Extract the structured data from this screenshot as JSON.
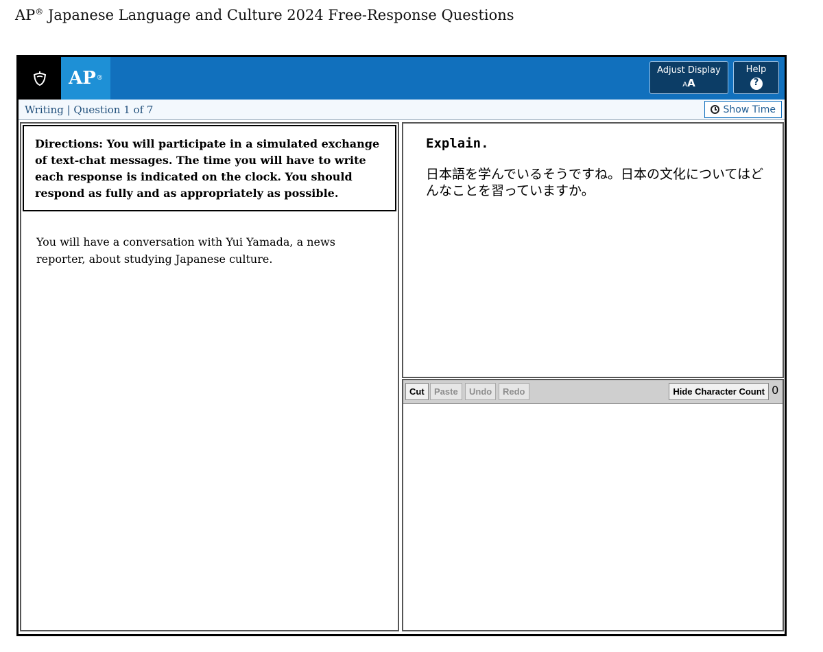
{
  "document": {
    "title": "AP",
    "title_mark": "®",
    "title_rest": " Japanese Language and Culture 2024 Free-Response Questions"
  },
  "header": {
    "logo_icon": "acorn-shield-icon",
    "ap_label": "AP",
    "ap_mark": "®",
    "adjust_display_label": "Adjust Display",
    "adjust_display_icon_small": "A",
    "adjust_display_icon_large": "A",
    "help_label": "Help",
    "help_icon": "?",
    "colors": {
      "bar": "#1170bd",
      "ap_box": "#1e90d6",
      "button": "#0c3d66"
    }
  },
  "subbar": {
    "section": "Writing",
    "separator": " | ",
    "question_progress": "Question 1 of 7",
    "show_time_label": "Show Time"
  },
  "left": {
    "directions": "Directions: You will participate in a simulated exchange of text-chat messages. The time you will have to write each response is indicated on the clock. You should respond as fully and as appropriately as possible.",
    "intro": "You will have a conversation with Yui Yamada, a news reporter, about studying Japanese culture."
  },
  "prompt": {
    "task": "Explain.",
    "question": "日本語を学んでいるそうですね。日本の文化についてはどんなことを習っていますか。"
  },
  "toolbar": {
    "cut": "Cut",
    "paste": "Paste",
    "undo": "Undo",
    "redo": "Redo",
    "hide_character_count": "Hide Character Count",
    "character_count": "0"
  },
  "answer": {
    "value": ""
  }
}
